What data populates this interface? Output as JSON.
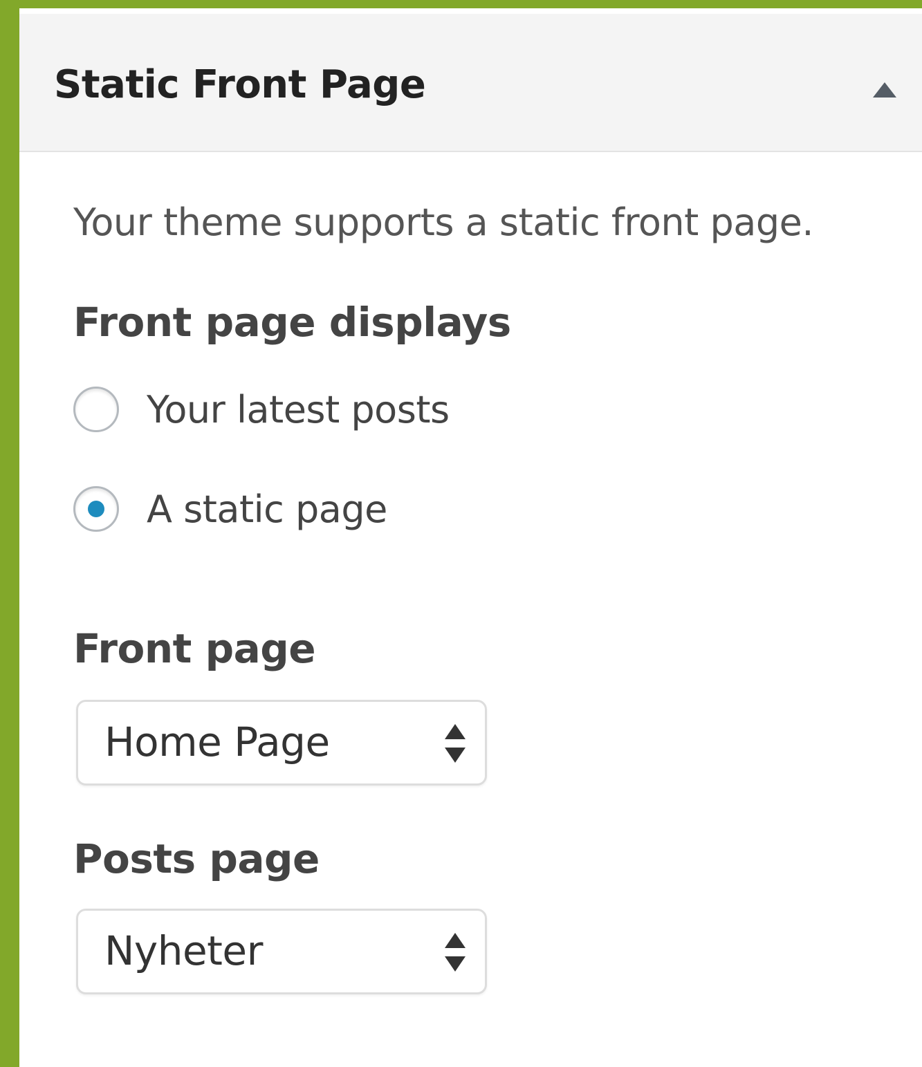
{
  "section": {
    "title": "Static Front Page",
    "toggle_icon": "triangle-up-icon",
    "description": "Your theme supports a static front page."
  },
  "front_page_displays": {
    "label": "Front page displays",
    "options": [
      {
        "label": "Your latest posts",
        "selected": false
      },
      {
        "label": "A static page",
        "selected": true
      }
    ]
  },
  "front_page": {
    "label": "Front page",
    "selected": "Home Page"
  },
  "posts_page": {
    "label": "Posts page",
    "selected": "Nyheter"
  },
  "colors": {
    "frame": "#82a82a",
    "header_bg": "#f4f4f4",
    "radio_selected": "#1e8cbe"
  }
}
